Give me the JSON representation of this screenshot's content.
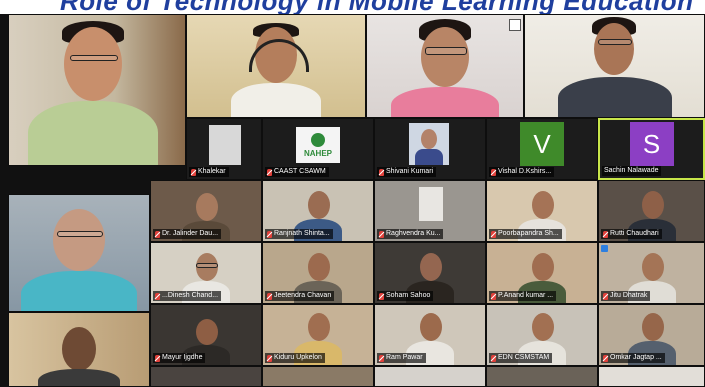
{
  "banner": {
    "text": "Role of Technology in Mobile Learning Education"
  },
  "colors": {
    "active_border": "#c8e64a",
    "muted_mic": "#e0403a",
    "name_bg": "#000000",
    "banner_text": "#1f3f9e"
  },
  "tiles": [
    {
      "name": "",
      "avatar": ""
    },
    {
      "name": "",
      "avatar": ""
    },
    {
      "name": "",
      "avatar": ""
    },
    {
      "name": "",
      "avatar": ""
    },
    {
      "name": "Khalekar",
      "avatar": ""
    },
    {
      "name": "CAAST CSAWM",
      "avatar": ""
    },
    {
      "name": "Shivani Kumari",
      "avatar": ""
    },
    {
      "name": "Vishal D.Kshirs...",
      "avatar": "V"
    },
    {
      "name": "Sachin Nalawade",
      "avatar": "S"
    },
    {
      "name": "",
      "avatar": ""
    },
    {
      "name": "Dr. Jalinder Dau...",
      "avatar": ""
    },
    {
      "name": "Ranjnath Shinta...",
      "avatar": ""
    },
    {
      "name": "Raghvendra Ku...",
      "avatar": ""
    },
    {
      "name": "Poorbapandra Sh...",
      "avatar": ""
    },
    {
      "name": "Rutti Chaudhari",
      "avatar": ""
    },
    {
      "name": "...Dinesh Chand...",
      "avatar": ""
    },
    {
      "name": "Jeetendra Chavan",
      "avatar": ""
    },
    {
      "name": "Soham Sahoo",
      "avatar": ""
    },
    {
      "name": "P.Anand kumar ...",
      "avatar": ""
    },
    {
      "name": "Jitu Dhatrak",
      "avatar": ""
    },
    {
      "name": "",
      "avatar": ""
    },
    {
      "name": "Mayur Ijgdhe",
      "avatar": ""
    },
    {
      "name": "Kiduru Upkelon",
      "avatar": ""
    },
    {
      "name": "Ram Pawar",
      "avatar": ""
    },
    {
      "name": "EDN CSMSTAM",
      "avatar": ""
    },
    {
      "name": "Omkar Jagtap ...",
      "avatar": ""
    }
  ]
}
